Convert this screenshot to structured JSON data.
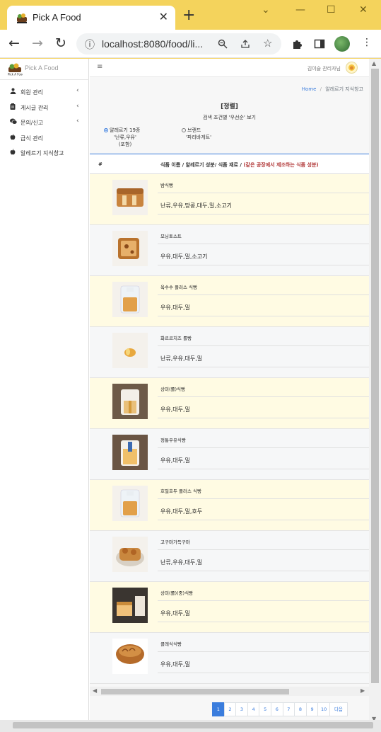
{
  "browser": {
    "tab_title": "Pick A Food",
    "url": "localhost:8080/food/li...",
    "new_tab": "+",
    "close": "✕",
    "minimize": "⌄",
    "min2": "—",
    "max": "☐",
    "win_close": "✕"
  },
  "sidebar": {
    "brand": "Pick A Food",
    "items": [
      {
        "icon": "user-icon",
        "glyph": "👤",
        "label": "회원 관리",
        "caret": "‹"
      },
      {
        "icon": "clipboard-icon",
        "glyph": "📋",
        "label": "게시글 관리",
        "caret": "‹"
      },
      {
        "icon": "comments-icon",
        "glyph": "💬",
        "label": "문의/신고",
        "caret": "‹"
      },
      {
        "icon": "apple-icon",
        "glyph": "🍎",
        "label": "급식 관리",
        "caret": ""
      },
      {
        "icon": "apple-icon",
        "glyph": "🍎",
        "label": "알레르기 지식창고",
        "caret": ""
      }
    ]
  },
  "topnav": {
    "menu": "≡",
    "user": "김이슬 관리자님"
  },
  "breadcrumb": {
    "home": "Home",
    "sep": "/",
    "current": "알레르기 지식창고"
  },
  "page": {
    "title": "[정렬]",
    "subtitle": "검색 조건별 '우선순' 보기",
    "option1_label": "알레르기 19종",
    "option1_sub1": "'난류,우유'",
    "option1_sub2": "(포함)",
    "option2_label": "브랜드",
    "option2_sub1": "'파리바게트'"
  },
  "table": {
    "col_hash": "#",
    "col_main": "식품 이름 / 알레르기 성분/ 식품 재료 / ",
    "col_note": "(같은 공장에서 제조하는 식품 성분)",
    "rows": [
      {
        "name": "밤식빵",
        "ingredients": "난류,우유,땅콩,대두,밀,소고기",
        "img": "bread-loaf"
      },
      {
        "name": "모닝토스트",
        "ingredients": "우유,대두,밀,소고기",
        "img": "toast"
      },
      {
        "name": "옥수수 플러스 식빵",
        "ingredients": "우유,대두,밀",
        "img": "bag-loaf"
      },
      {
        "name": "화르르치즈 롤빵",
        "ingredients": "난류,우유,대두,밀",
        "img": "roll"
      },
      {
        "name": "상미(쫄)식빵",
        "ingredients": "우유,대두,밀",
        "img": "bag-loaf-dark"
      },
      {
        "name": "정통우유식빵",
        "ingredients": "우유,대두,밀",
        "img": "milk-loaf"
      },
      {
        "name": "호밀호두 플러스 식빵",
        "ingredients": "우유,대두,밀,호두",
        "img": "bag-loaf"
      },
      {
        "name": "고구마가득구마",
        "ingredients": "난류,우유,대두,밀",
        "img": "sweet-potato"
      },
      {
        "name": "상미(쫄)(중)식빵",
        "ingredients": "우유,대두,밀",
        "img": "box-loaf"
      },
      {
        "name": "클래식식빵",
        "ingredients": "우유,대두,밀",
        "img": "round-loaf"
      }
    ]
  },
  "pagination": {
    "pages": [
      "1",
      "2",
      "3",
      "4",
      "5",
      "6",
      "7",
      "8",
      "9",
      "10"
    ],
    "next": "다음",
    "active": "1"
  },
  "colors": {
    "accent": "#3b7ddd",
    "row_yellow": "#fffbe3",
    "row_gray": "#f6f7f8",
    "chrome": "#f4d35c"
  }
}
